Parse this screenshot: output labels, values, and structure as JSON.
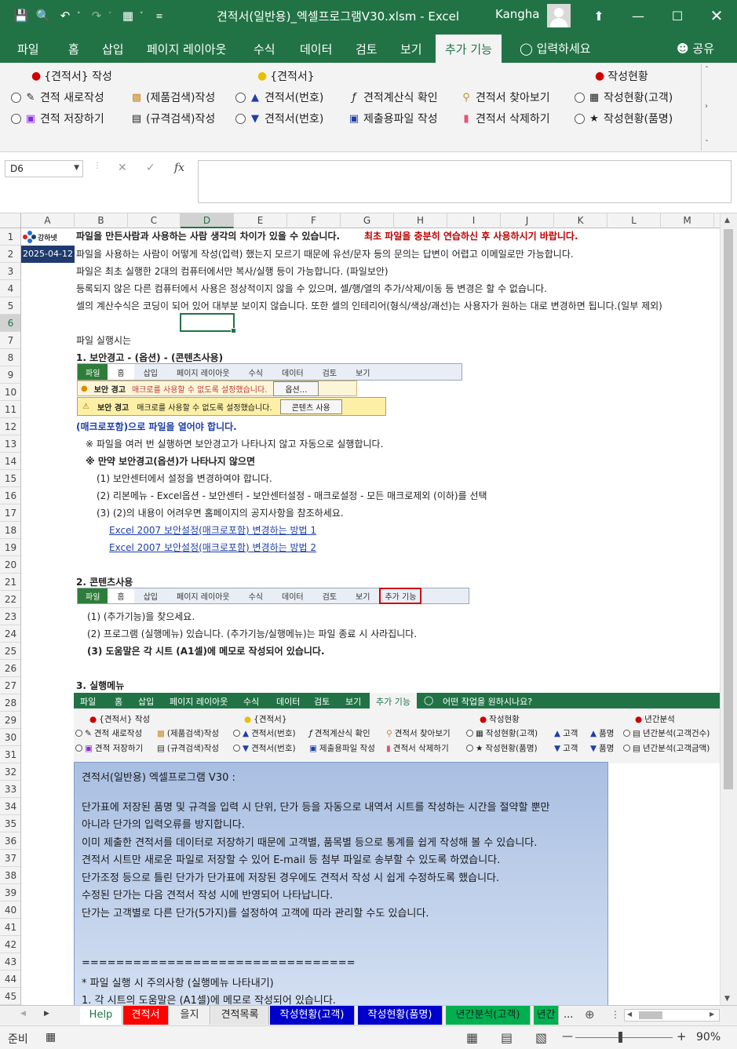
{
  "window": {
    "title": "견적서(일반용)_엑셀프로그램V30.xlsm  -  Excel",
    "user": "Kangha",
    "colors": {
      "excel_green": "#217346",
      "selection_green": "#217346",
      "date_cell": "#1f3a6e"
    }
  },
  "qat": {
    "icons": [
      "save-icon",
      "print-preview-icon",
      "undo-icon",
      "redo-icon",
      "form-icon",
      "customize-icon"
    ]
  },
  "ribbon_tabs": [
    "파일",
    "홈",
    "삽입",
    "페이지 레이아웃",
    "수식",
    "데이터",
    "검토",
    "보기",
    "추가 기능"
  ],
  "tell_me": "입력하세요",
  "share": "공유",
  "ribbon": {
    "group1_title": "{견적서} 작성",
    "group2_title": "{견적서}",
    "group3_title": "작성현황",
    "row1": [
      "견적 새로작성",
      "(제품검색)작성",
      "견적서(번호)",
      "견적계산식 확인",
      "견적서 찾아보기",
      "작성현황(고객)"
    ],
    "row2": [
      "견적 저장하기",
      "(규격검색)작성",
      "견적서(번호)",
      "제출용파일 작성",
      "견적서 삭제하기",
      "작성현황(품명)"
    ]
  },
  "formula_bar": {
    "name_box": "D6",
    "fx": "fx",
    "value": ""
  },
  "columns": [
    "A",
    "B",
    "C",
    "D",
    "E",
    "F",
    "G",
    "H",
    "I",
    "J",
    "K",
    "L",
    "M"
  ],
  "rows": [
    "1",
    "2",
    "3",
    "4",
    "5",
    "6",
    "7",
    "8",
    "9",
    "10",
    "11",
    "12",
    "13",
    "14",
    "15",
    "16",
    "17",
    "18",
    "19",
    "20",
    "21",
    "22",
    "23",
    "24",
    "25",
    "26",
    "27",
    "28",
    "29",
    "30",
    "31",
    "32",
    "33",
    "34",
    "35",
    "36",
    "37",
    "38",
    "39",
    "40",
    "41",
    "42",
    "43",
    "44",
    "45"
  ],
  "sheet": {
    "logo_text": "강하넷",
    "date": "2025-04-12",
    "r1_a": "파일을 만든사람과 사용하는 사람 생각의 차이가 있을 수 있습니다.",
    "r1_b": "최초 파일을 충분히 연습하신 후 사용하시기 바랍니다.",
    "r2": "파일을 사용하는 사람이 어떻게 작성(입력) 했는지 모르기 때문에 유선/문자 등의 문의는 답변이 어렵고 이메일로만 가능합니다.",
    "r3": "파일은 최초 실행한 2대의 컴퓨터에서만 복사/실행 등이 가능합니다.  (파일보안)",
    "r4": "등록되지 않은 다른 컴퓨터에서 사용은 정상적이지 않을 수 있으며, 셀/행/열의 추가/삭제/이동 등 변경은 할 수 없습니다.",
    "r5": "셀의 계산수식은 코딩이 되어 있어 대부분 보이지 않습니다. 또한 셀의 인테리어(형식/색상/괘선)는 사용자가 원하는 대로 변경하면 됩니다.(일부 제외)",
    "r7": "파일 실행시는",
    "r8": "1. 보안경고 - (옵션) - (콘텐츠사용)",
    "mini_tabs": [
      "파일",
      "홈",
      "삽입",
      "페이지 레이아웃",
      "수식",
      "데이터",
      "검토",
      "보기"
    ],
    "warn1_title": "보안 경고",
    "warn1_msg": "매크로를 사용할 수 없도록 설정했습니다.",
    "warn1_btn": "옵션...",
    "warn2_title": "보안 경고",
    "warn2_msg": "매크로를 사용할 수 없도록 설정했습니다.",
    "warn2_btn": "콘텐츠 사용",
    "r12": "(매크로포함)으로 파일을 열어야 합니다.",
    "r13": "※ 파일을 여러 번 실행하면 보안경고가 나타나지 않고 자동으로 실행합니다.",
    "r14": "※ 만약 보안경고(옵션)가 나타나지 않으면",
    "r15": "(1) 보안센터에서 설정을 변경하여야 합니다.",
    "r16": "(2) 리본메뉴 - Excel옵션 - 보안센터 - 보안센터설정 - 매크로설정 - 모든 매크로제외 (이하)를 선택",
    "r17": "(3) (2)의 내용이 어려우면 홈페이지의 공지사항을 참조하세요.",
    "r18": "Excel 2007 보안설정(매크로포함) 변경하는 방법 1",
    "r19": "Excel 2007 보안설정(매크로포함) 변경하는 방법 2",
    "r21": "2. 콘텐츠사용",
    "mini_tabs2": [
      "파일",
      "홈",
      "삽입",
      "페이지 레이아웃",
      "수식",
      "데이터",
      "검토",
      "보기",
      "추가 기능"
    ],
    "r23": "(1) (추가기능)을 찾으세요.",
    "r24": "(2) 프로그램 (실행메뉴) 있습니다. (추가기능/실행메뉴)는 파일 종료 시 사라집니다.",
    "r25": "(3) 도움말은 각 시트 (A1셀)에 메모로 작성되어 있습니다.",
    "r27": "3. 실행메뉴",
    "menu_tabs": [
      "파일",
      "홈",
      "삽입",
      "페이지 레이아웃",
      "수식",
      "데이터",
      "검토",
      "보기",
      "추가 기능",
      "어떤 작업을 원하시나요?"
    ],
    "menu_groups": [
      "{견적서} 작성",
      "{견적서}",
      "작성현황",
      "년간분석"
    ],
    "menu_row1": [
      "견적 새로작성",
      "(제품검색)작성",
      "견적서(번호)",
      "견적계산식 확인",
      "견적서 찾아보기",
      "작성현황(고객)",
      "고객",
      "품명",
      "년간분석(고객건수)"
    ],
    "menu_row2": [
      "견적 저장하기",
      "(규격검색)작성",
      "견적서(번호)",
      "제출용파일 작성",
      "견적서 삭제하기",
      "작성현황(품명)",
      "고객",
      "품명",
      "년간분석(고객금액)"
    ],
    "note": [
      "견적서(일반용) 엑셀프로그램 V30 :",
      "단가표에 저장된 품명 및 규격을 입력 시 단위, 단가 등을 자동으로 내역서 시트를 작성하는 시간을 절약할 뿐만",
      "아니라 단가의 입력오류를 방지합니다.",
      "이미 제출한 견적서를 데이터로 저장하기 때문에 고객별, 품목별 등으로 통계를 쉽게 작성해 볼 수 있습니다.",
      "견적서 시트만 새로운 파일로 저장할 수 있어 E-mail 등 첨부 파일로 송부할 수 있도록 하였습니다.",
      "단가조정 등으로 틀린 단가가 단가표에 저장된 경우에도 견적서 작성 시 쉽게 수정하도록 했습니다.",
      "수정된 단가는 다음 견적서 작성 시에 반영되어 나타납니다.",
      "단가는 고객별로 다른 단가(5가지)를 설정하여 고객에 따라 관리할 수도 있습니다.",
      "================================",
      "* 파일 실행 시 주의사항 (실행메뉴 나타내기)",
      "1. 각 시트의 도움말은 (A1셀)에 메모로 작성되어 있습니다."
    ]
  },
  "sheet_tabs": [
    {
      "label": "Help",
      "bg": "#ffffff",
      "fg": "#217346"
    },
    {
      "label": "견적서",
      "bg": "#ff0000",
      "fg": "#ffffff"
    },
    {
      "label": "을지",
      "bg": "#f0f0f0",
      "fg": "#333333"
    },
    {
      "label": "견적목록",
      "bg": "#e6e6e6",
      "fg": "#222222"
    },
    {
      "label": "작성현황(고객)",
      "bg": "#0000cc",
      "fg": "#ffffff"
    },
    {
      "label": "작성현황(품명)",
      "bg": "#0000cc",
      "fg": "#ffffff"
    },
    {
      "label": "년간분석(고객)",
      "bg": "#00b050",
      "fg": "#222222"
    },
    {
      "label": "년간",
      "bg": "#00b050",
      "fg": "#222222"
    }
  ],
  "sheet_tab_more": "...",
  "status": {
    "ready": "준비",
    "zoom": "90%"
  }
}
